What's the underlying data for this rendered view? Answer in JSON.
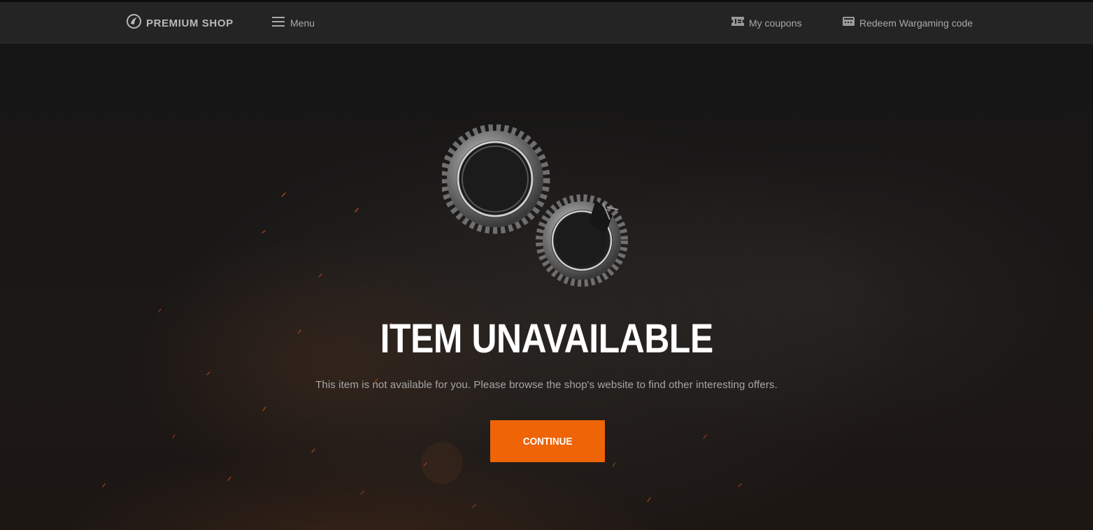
{
  "header": {
    "logo_label": "PREMIUM SHOP",
    "menu_label": "Menu",
    "coupons_label": "My coupons",
    "redeem_label": "Redeem Wargaming code"
  },
  "icons": {
    "logo": "wargaming-logo-icon",
    "menu": "hamburger-menu-icon",
    "coupons": "coupon-ticket-icon",
    "redeem": "code-card-icon",
    "illustration": "broken-gears-icon"
  },
  "main": {
    "title": "ITEM UNAVAILABLE",
    "message": "This item is not available for you. Please browse the shop's website to find other interesting offers.",
    "continue_label": "CONTINUE"
  },
  "colors": {
    "accent": "#ee6407",
    "header_bg": "#242424",
    "page_bg": "#151515",
    "ember": "#d6521a"
  }
}
